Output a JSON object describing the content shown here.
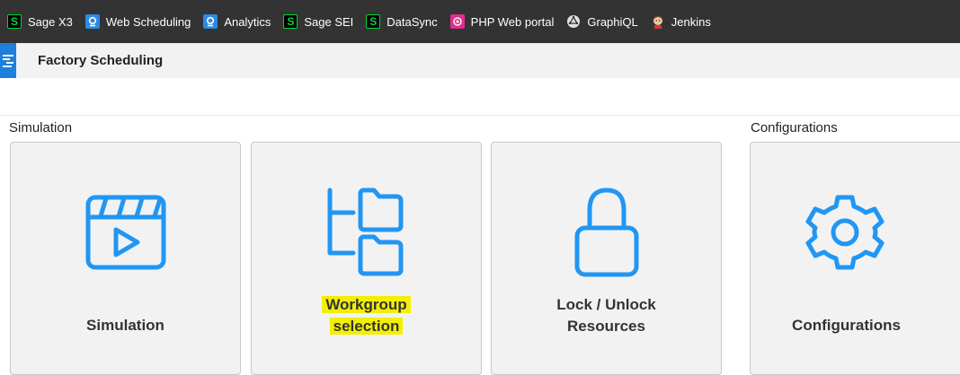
{
  "bookmarks": [
    {
      "label": "Sage X3",
      "icon": "sage-icon"
    },
    {
      "label": "Web Scheduling",
      "icon": "web-scheduling-icon"
    },
    {
      "label": "Analytics",
      "icon": "analytics-icon"
    },
    {
      "label": "Sage SEI",
      "icon": "sage-icon"
    },
    {
      "label": "DataSync",
      "icon": "sage-icon"
    },
    {
      "label": "PHP Web portal",
      "icon": "php-icon"
    },
    {
      "label": "GraphiQL",
      "icon": "graphiql-icon"
    },
    {
      "label": "Jenkins",
      "icon": "jenkins-icon"
    }
  ],
  "app": {
    "title": "Factory Scheduling"
  },
  "sections": {
    "simulation": "Simulation",
    "configurations": "Configurations"
  },
  "cards": {
    "simulation": {
      "line1": "Simulation"
    },
    "workgroup": {
      "line1": "Workgroup",
      "line2": "selection"
    },
    "lock": {
      "line1": "Lock / Unlock",
      "line2": "Resources"
    },
    "configurations": {
      "line1": "Configurations"
    }
  },
  "colors": {
    "accent": "#2196f3",
    "highlight": "#f3ef00",
    "topbar": "#333333",
    "sage_green": "#00d639"
  }
}
